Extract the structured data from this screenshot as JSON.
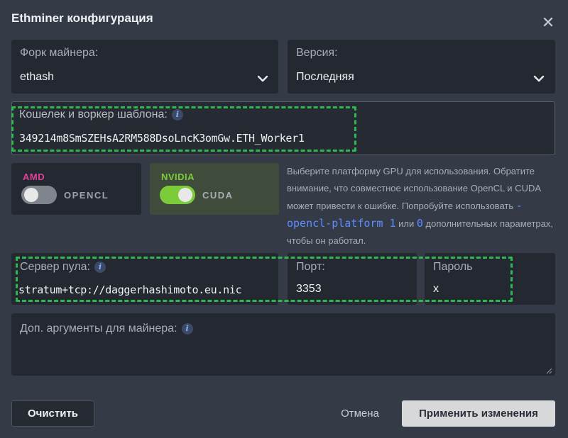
{
  "dialog": {
    "title": "Ethminer конфигурация",
    "close_icon": "close-icon"
  },
  "fork": {
    "label": "Форк майнера:",
    "selected": "ethash"
  },
  "version": {
    "label": "Версия:",
    "selected": "Последняя"
  },
  "wallet": {
    "label": "Кошелек и воркер шаблона:",
    "value": "349214m8SmSZEHsA2RM588DsoLncK3omGw.ETH_Worker1"
  },
  "gpu": {
    "amd": {
      "brand": "AMD",
      "api": "OPENCL",
      "enabled": false,
      "brand_color": "#e0409a"
    },
    "nvidia": {
      "brand": "NVIDIA",
      "api": "CUDA",
      "enabled": true,
      "brand_color": "#7ccc3a"
    },
    "note_part1": "Выберите платформу GPU для использования. Обратите внимание, что совместное использование OpenCL и CUDA может привести к ошибке. Попробуйте использовать",
    "note_code1": "-opencl-platform 1",
    "note_or": "или",
    "note_code2": "0",
    "note_part2": "дополнительных параметрах, чтобы он работал."
  },
  "pool": {
    "label": "Сервер пула:",
    "value": "stratum+tcp://daggerhashimoto.eu.nic"
  },
  "port": {
    "label": "Порт:",
    "value": "3353"
  },
  "password": {
    "label": "Пароль",
    "value": "x"
  },
  "extra_args": {
    "label": "Доп. аргументы для майнера:",
    "value": ""
  },
  "buttons": {
    "clear": "Очистить",
    "cancel": "Отмена",
    "apply": "Применить изменения"
  },
  "colors": {
    "background": "#343a46",
    "field": "#242931",
    "highlight": "#2fb852",
    "accent_link": "#5b8fff"
  }
}
